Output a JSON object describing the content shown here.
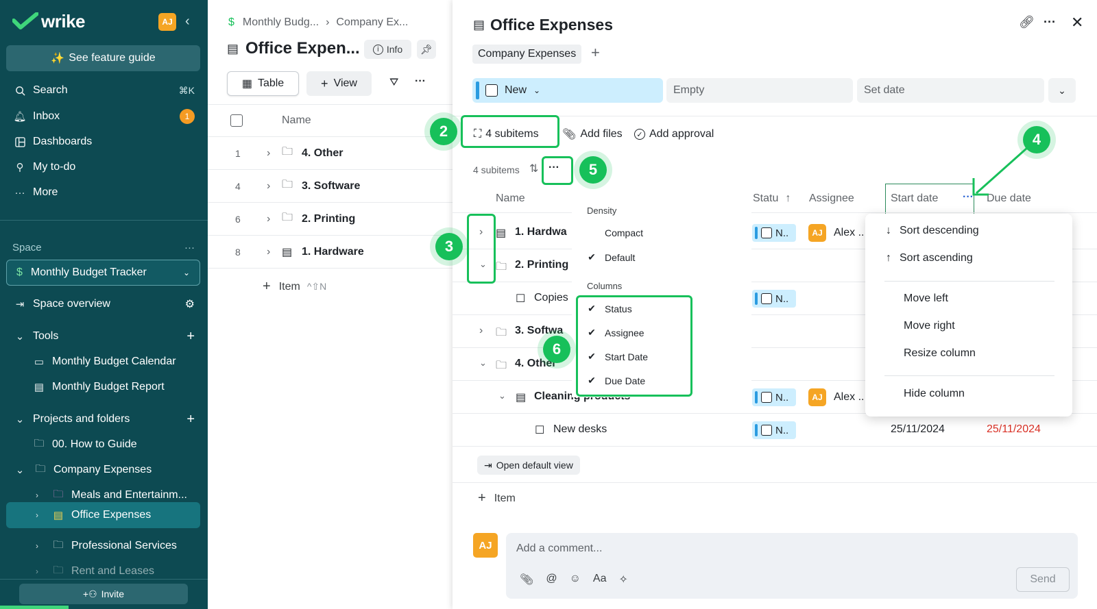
{
  "sidebar": {
    "brand": "wrike",
    "avatar_initials": "AJ",
    "feature_guide": "See feature guide",
    "nav": [
      {
        "label": "Search",
        "shortcut": "⌘K"
      },
      {
        "label": "Inbox",
        "badge": "1"
      },
      {
        "label": "Dashboards"
      },
      {
        "label": "My to-do"
      },
      {
        "label": "More"
      }
    ],
    "space_label": "Space",
    "space_name": "Monthly Budget Tracker",
    "space_overview": "Space overview",
    "tools_label": "Tools",
    "tools": [
      "Monthly Budget Calendar",
      "Monthly Budget Report"
    ],
    "projects_label": "Projects and folders",
    "folders": [
      {
        "label": "00. How to Guide"
      },
      {
        "label": "Company Expenses"
      },
      {
        "label": "Meals and Entertainm..."
      },
      {
        "label": "Office Expenses"
      },
      {
        "label": "Professional Services"
      },
      {
        "label": "Rent and Leases"
      }
    ],
    "invite": "Invite"
  },
  "list": {
    "breadcrumb": [
      "Monthly Budg...",
      "Company Ex..."
    ],
    "title": "Office Expen...",
    "info": "Info",
    "view_table": "Table",
    "view_add": "View",
    "col_name": "Name",
    "rows": [
      {
        "num": "1",
        "label": "4. Other"
      },
      {
        "num": "4",
        "label": "3. Software"
      },
      {
        "num": "6",
        "label": "2. Printing"
      },
      {
        "num": "8",
        "label": "1. Hardware"
      }
    ],
    "add_item": "Item",
    "add_item_shortcut": "^⇧N"
  },
  "detail": {
    "title": "Office Expenses",
    "parent_tag": "Company Expenses",
    "status": "New",
    "assignee_field": "Empty",
    "date_field": "Set date",
    "subitems_btn": "4 subitems",
    "add_files": "Add files",
    "add_approval": "Add approval",
    "subitems_count": "4 subitems",
    "columns": {
      "name": "Name",
      "status": "Statu",
      "assignee": "Assignee",
      "start": "Start date",
      "due": "Due date"
    },
    "rows": [
      {
        "label": "1. Hardwa",
        "status": "N..",
        "assignee": "Alex ..",
        "initials": "AJ"
      },
      {
        "label": "2. Printing"
      },
      {
        "label": "Copies",
        "status": "N.."
      },
      {
        "label": "3. Softwa"
      },
      {
        "label": "4. Other"
      },
      {
        "label": "Cleaning products",
        "status": "N..",
        "assignee": "Alex ..",
        "initials": "AJ"
      },
      {
        "label": "New desks",
        "status": "N..",
        "start": "25/11/2024",
        "due": "25/11/2024"
      }
    ],
    "open_default": "Open default view",
    "add_item": "Item",
    "comment_placeholder": "Add a comment...",
    "comment_avatar": "AJ",
    "send": "Send"
  },
  "density_menu": {
    "density_label": "Density",
    "compact": "Compact",
    "default": "Default",
    "columns_label": "Columns",
    "columns": [
      "Status",
      "Assignee",
      "Start Date",
      "Due Date"
    ]
  },
  "column_menu": {
    "items": [
      "Sort descending",
      "Sort ascending",
      "Move left",
      "Move right",
      "Resize column",
      "Hide column"
    ]
  },
  "badges": [
    "2",
    "3",
    "4",
    "5",
    "6"
  ],
  "colors": {
    "sidebar": "#0d4a52",
    "accent_green": "#17c05a",
    "status_blue": "#cdeefe",
    "due_red": "#d93025"
  }
}
